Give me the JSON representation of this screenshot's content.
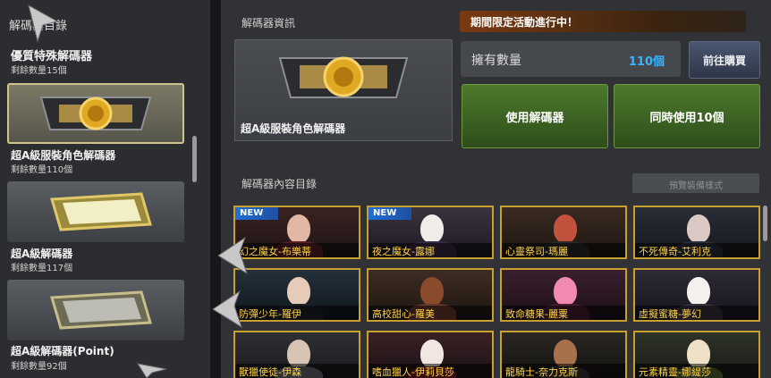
{
  "left": {
    "header": "解碼器目錄",
    "group": {
      "title": "優質特殊解碼器",
      "count": "剩餘數量15個"
    },
    "items": [
      {
        "name": "超A級服裝角色解碼器",
        "count": "剩餘數量110個"
      },
      {
        "name": "超A級解碼器",
        "count": "剩餘數量117個"
      },
      {
        "name": "超A級解碼器(Point)",
        "count": "剩餘數量92個"
      }
    ]
  },
  "info": {
    "section_title": "解碼器資訊",
    "decoder_name": "超A級服裝角色解碼器"
  },
  "banner": "期間限定活動進行中！",
  "quantity": {
    "label": "擁有數量",
    "value": "110個"
  },
  "buttons": {
    "go_buy": "前往購買",
    "use": "使用解碼器",
    "use_10": "同時使用10個",
    "preview": "預覽裝備樣式"
  },
  "contents": {
    "section_title": "解碼器內容目錄",
    "new_badge": "NEW",
    "items": [
      {
        "name": "幻之魔女-布樂蒂"
      },
      {
        "name": "夜之魔女-露娜"
      },
      {
        "name": "心靈祭司-瑪麗"
      },
      {
        "name": "不死傳奇-艾利克"
      },
      {
        "name": "防彈少年-羅伊"
      },
      {
        "name": "高校甜心-羅美"
      },
      {
        "name": "致命糖果-麗粟"
      },
      {
        "name": "虛擬蜜糖-夢幻"
      },
      {
        "name": "獸獵使徒-伊森"
      },
      {
        "name": "嗜血獵人-伊莉貝莎"
      },
      {
        "name": "龍騎士-奈力克斯"
      },
      {
        "name": "元素精靈-娜緹莎"
      }
    ]
  },
  "colors": {
    "accent_gold": "#c9a02f",
    "qty_blue": "#37b4ff",
    "green_button": "#4d7a2c"
  }
}
